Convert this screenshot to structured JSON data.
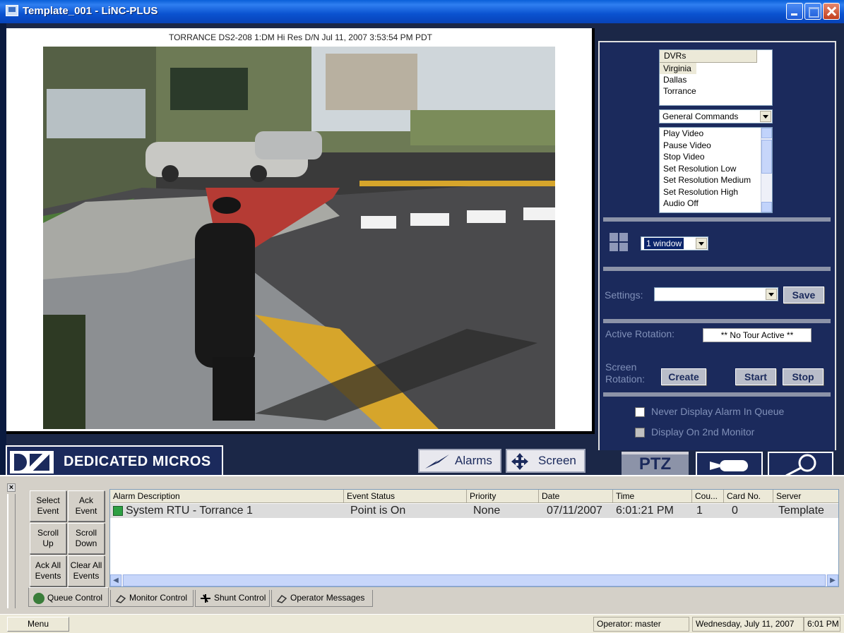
{
  "window": {
    "title": "Template_001 - LiNC-PLUS"
  },
  "video": {
    "header": "TORRANCE DS2-208 1:DM Hi Res D/N Jul 11, 2007 3:53:54 PM PDT"
  },
  "control_panel": {
    "dvr_list": {
      "header": "DVRs",
      "items": [
        "Virginia",
        "Dallas",
        "Torrance"
      ],
      "selected": "Virginia"
    },
    "command_category": "General Commands",
    "commands": [
      "Play Video",
      "Pause Video",
      "Stop Video",
      "Set  Resolution Low",
      "Set  Resolution Medium",
      "Set  Resolution High",
      "Audio Off"
    ],
    "layout_select": "1 window",
    "settings_label": "Settings:",
    "settings_value": "",
    "save_label": "Save",
    "active_rotation_label": "Active Rotation:",
    "active_rotation_value": "** No Tour Active **",
    "screen_rotation_label_1": "Screen",
    "screen_rotation_label_2": "Rotation:",
    "create_label": "Create",
    "start_label": "Start",
    "stop_label": "Stop",
    "never_display_label": "Never Display Alarm In Queue",
    "second_monitor_label": "Display On 2nd Monitor"
  },
  "bottom_strip": {
    "brand": "DEDICATED MICROS",
    "alarms_label": "Alarms",
    "screen_label": "Screen",
    "ptz_label": "PTZ"
  },
  "queue": {
    "buttons": {
      "select_event": [
        "Select",
        "Event"
      ],
      "ack_event": [
        "Ack",
        "Event"
      ],
      "scroll_up": [
        "Scroll",
        "Up"
      ],
      "scroll_down": [
        "Scroll",
        "Down"
      ],
      "ack_all": [
        "Ack All",
        "Events"
      ],
      "clear_all": [
        "Clear All",
        "Events"
      ]
    },
    "columns": [
      "Alarm Description",
      "Event Status",
      "Priority",
      "Date",
      "Time",
      "Cou...",
      "Card No.",
      "Server"
    ],
    "rows": [
      [
        "System RTU - Torrance 1",
        "Point is On",
        "None",
        "07/11/2007",
        "6:01:21 PM",
        "1",
        "0",
        "Template"
      ]
    ],
    "tabs": [
      "Queue Control",
      "Monitor Control",
      "Shunt Control",
      "Operator Messages"
    ]
  },
  "statusbar": {
    "menu": "Menu",
    "operator": "Operator: master",
    "date": "Wednesday, July 11, 2007",
    "time": "6:01 PM"
  },
  "colors": {
    "panel": "#1b2a5c",
    "titlebar": "#0a52d0",
    "label": "#8090b8"
  }
}
